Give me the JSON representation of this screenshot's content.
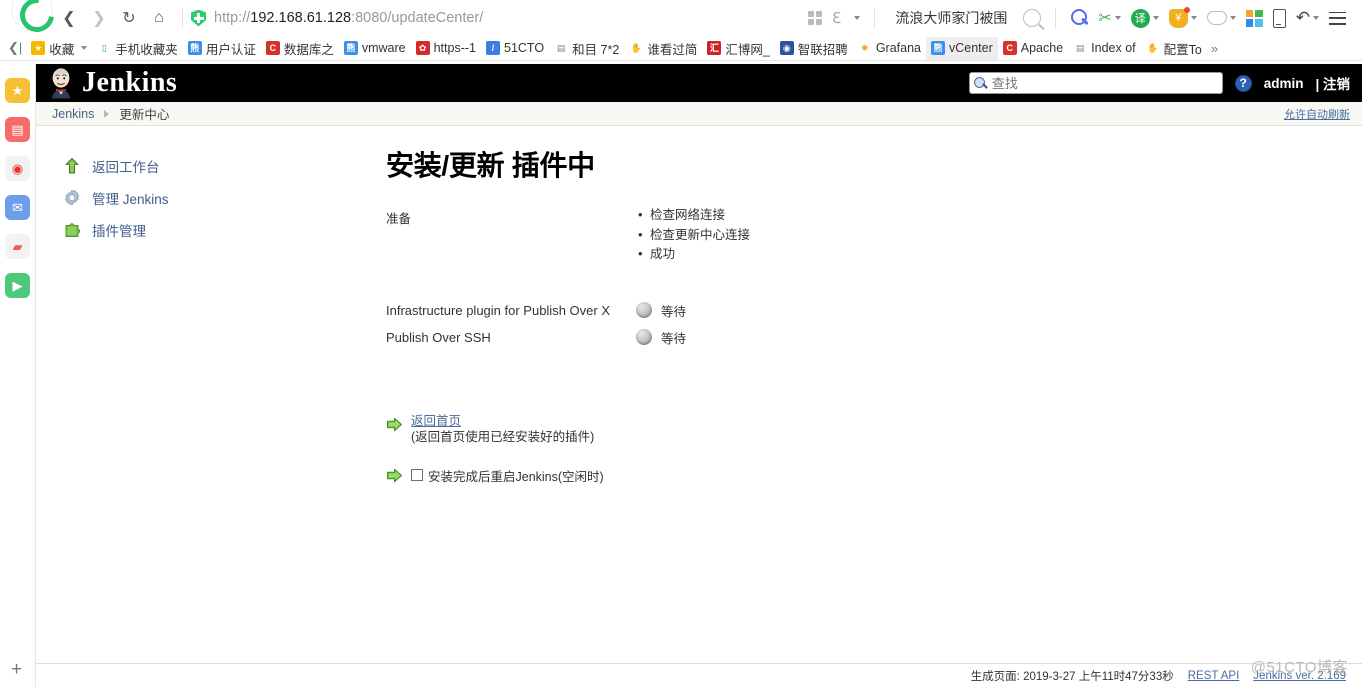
{
  "browser": {
    "nav": {
      "back_icon": "back-arrow-icon",
      "forward_icon": "forward-arrow-icon",
      "reload_icon": "reload-icon",
      "home_icon": "home-icon"
    },
    "address": {
      "security_icon": "green-shield-icon",
      "scheme": "http://",
      "host": "192.168.61.128",
      "port_path": ":8080/updateCenter/",
      "full_url": "http://192.168.61.128:8080/updateCenter/"
    },
    "toolbar_right": {
      "apps_grid_icon": "apps-grid-icon",
      "collections_icon": "collections-icon",
      "chevron_icon": "chevron-down-icon",
      "hot_search_text": "流浪大师家门被围",
      "search_icon": "search-icon",
      "find_icon": "magnifier-icon",
      "screenshot_icon": "scissors-icon",
      "translate_icon": "translate-icon",
      "translate_glyph": "译",
      "wallet_icon": "shield-reward-icon",
      "wallet_glyph": "¥",
      "game_icon": "game-controller-icon",
      "quadrant_icon": "four-square-icon",
      "mobile_icon": "mobile-view-icon",
      "undo_icon": "undo-icon",
      "menu_icon": "hamburger-menu-icon"
    },
    "bookmarks": {
      "collapse_left_icon": "collapse-left-icon",
      "overflow_icon": "chevron-right-overflow",
      "items": [
        {
          "label": "收藏",
          "icon": "star-icon",
          "color": "#f5b700",
          "glyph": "★",
          "has_caret": true
        },
        {
          "label": "手机收藏夹",
          "icon": "mobile-icon",
          "color": "#ffffff",
          "glyph": "▯",
          "text_color": "#2db84d"
        },
        {
          "label": "用户认证",
          "icon": "baidu-icon",
          "color": "#3c8fe8",
          "glyph": "熊"
        },
        {
          "label": "数据库之",
          "icon": "csdn-icon",
          "color": "#d6322b",
          "glyph": "C"
        },
        {
          "label": "vmware",
          "icon": "baidu-icon",
          "color": "#3c8fe8",
          "glyph": "熊"
        },
        {
          "label": "https--1",
          "icon": "huawei-icon",
          "color": "#d8282a",
          "glyph": "✿"
        },
        {
          "label": "51CTO",
          "icon": "cto-icon",
          "color": "#3d7de0",
          "glyph": "/"
        },
        {
          "label": "和目 7*2",
          "icon": "page-icon",
          "color": "#ffffff",
          "glyph": "▤",
          "text_color": "#888"
        },
        {
          "label": "谁看过简",
          "icon": "hand-icon",
          "color": "#ffffff",
          "glyph": "✋",
          "text_color": "#6f7f99"
        },
        {
          "label": "汇博网_",
          "icon": "huibo-icon",
          "color": "#cc2222",
          "glyph": "汇"
        },
        {
          "label": "智联招聘",
          "icon": "zhaopin-icon",
          "color": "#2f4f9f",
          "glyph": "◉"
        },
        {
          "label": "Grafana",
          "icon": "grafana-icon",
          "color": "#ffffff",
          "glyph": "✹",
          "text_color": "#f5a623"
        },
        {
          "label": "vCenter",
          "icon": "baidu-icon",
          "color": "#3c8fe8",
          "glyph": "熊",
          "active": true
        },
        {
          "label": "Apache",
          "icon": "csdn-icon",
          "color": "#d6322b",
          "glyph": "C"
        },
        {
          "label": "Index of",
          "icon": "page-icon",
          "color": "#ffffff",
          "glyph": "▤",
          "text_color": "#888"
        },
        {
          "label": "配置To",
          "icon": "hand-icon",
          "color": "#ffffff",
          "glyph": "✋",
          "text_color": "#6f7f99"
        }
      ]
    },
    "app_rail": {
      "items": [
        {
          "name": "favorites-app-icon",
          "glyph": "★",
          "color": "#f7c034"
        },
        {
          "name": "news-app-icon",
          "glyph": "▤",
          "color": "#f76b6b"
        },
        {
          "name": "weibo-app-icon",
          "glyph": "◉",
          "color": "#f2f2f2",
          "glyph_color": "#e6332a"
        },
        {
          "name": "mail-app-icon",
          "glyph": "✉",
          "color": "#6c9fe8"
        },
        {
          "name": "game-app-icon",
          "glyph": "▰",
          "color": "#f2f2f2",
          "glyph_color": "#f05a4f"
        },
        {
          "name": "video-app-icon",
          "glyph": "▶",
          "color": "#4cc97a"
        }
      ],
      "add_label": "+"
    }
  },
  "jenkins": {
    "header": {
      "logo_name": "jenkins-butler-logo",
      "title": "Jenkins",
      "search_placeholder": "查找",
      "search_value": "",
      "help_label": "?",
      "user": "admin",
      "logout_sep": "|",
      "logout": "注销"
    },
    "breadcrumb": {
      "root": "Jenkins",
      "current": "更新中心",
      "auto_refresh": "允许自动刷新"
    },
    "sidebar": {
      "items": [
        {
          "label": "返回工作台",
          "icon": "up-arrow-icon",
          "color": "#5aa02c"
        },
        {
          "label": "管理 Jenkins",
          "icon": "gear-icon",
          "color": "#b8c4d6"
        },
        {
          "label": "插件管理",
          "icon": "plugin-puzzle-icon",
          "color": "#5aa02c"
        }
      ]
    },
    "main": {
      "title": "安装/更新 插件中",
      "prepare_label": "准备",
      "prepare_steps": [
        "检查网络连接",
        "检查更新中心连接",
        "成功"
      ],
      "plugins": [
        {
          "name": "Infrastructure plugin for Publish Over X",
          "status": "等待",
          "status_icon": "grey-ball-icon"
        },
        {
          "name": "Publish Over SSH",
          "status": "等待",
          "status_icon": "grey-ball-icon"
        }
      ],
      "actions": {
        "home_link": "返回首页",
        "home_note": "(返回首页使用已经安装好的插件)",
        "restart_checkbox_label": "安装完成后重启Jenkins(空闲时)",
        "restart_checked": false,
        "arrow_icon": "green-right-arrow-icon"
      }
    },
    "footer": {
      "generated": "生成页面: 2019-3-27 上午11时47分33秒",
      "rest_api": "REST API",
      "version": "Jenkins ver. 2.169"
    },
    "watermark": "@51CTO博客"
  }
}
